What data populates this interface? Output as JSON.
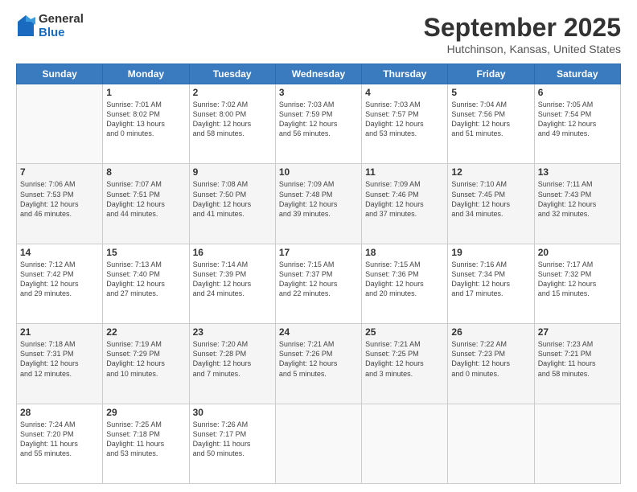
{
  "header": {
    "logo_general": "General",
    "logo_blue": "Blue",
    "month_title": "September 2025",
    "location": "Hutchinson, Kansas, United States"
  },
  "weekdays": [
    "Sunday",
    "Monday",
    "Tuesday",
    "Wednesday",
    "Thursday",
    "Friday",
    "Saturday"
  ],
  "weeks": [
    [
      {
        "day": "",
        "info": ""
      },
      {
        "day": "1",
        "info": "Sunrise: 7:01 AM\nSunset: 8:02 PM\nDaylight: 13 hours\nand 0 minutes."
      },
      {
        "day": "2",
        "info": "Sunrise: 7:02 AM\nSunset: 8:00 PM\nDaylight: 12 hours\nand 58 minutes."
      },
      {
        "day": "3",
        "info": "Sunrise: 7:03 AM\nSunset: 7:59 PM\nDaylight: 12 hours\nand 56 minutes."
      },
      {
        "day": "4",
        "info": "Sunrise: 7:03 AM\nSunset: 7:57 PM\nDaylight: 12 hours\nand 53 minutes."
      },
      {
        "day": "5",
        "info": "Sunrise: 7:04 AM\nSunset: 7:56 PM\nDaylight: 12 hours\nand 51 minutes."
      },
      {
        "day": "6",
        "info": "Sunrise: 7:05 AM\nSunset: 7:54 PM\nDaylight: 12 hours\nand 49 minutes."
      }
    ],
    [
      {
        "day": "7",
        "info": "Sunrise: 7:06 AM\nSunset: 7:53 PM\nDaylight: 12 hours\nand 46 minutes."
      },
      {
        "day": "8",
        "info": "Sunrise: 7:07 AM\nSunset: 7:51 PM\nDaylight: 12 hours\nand 44 minutes."
      },
      {
        "day": "9",
        "info": "Sunrise: 7:08 AM\nSunset: 7:50 PM\nDaylight: 12 hours\nand 41 minutes."
      },
      {
        "day": "10",
        "info": "Sunrise: 7:09 AM\nSunset: 7:48 PM\nDaylight: 12 hours\nand 39 minutes."
      },
      {
        "day": "11",
        "info": "Sunrise: 7:09 AM\nSunset: 7:46 PM\nDaylight: 12 hours\nand 37 minutes."
      },
      {
        "day": "12",
        "info": "Sunrise: 7:10 AM\nSunset: 7:45 PM\nDaylight: 12 hours\nand 34 minutes."
      },
      {
        "day": "13",
        "info": "Sunrise: 7:11 AM\nSunset: 7:43 PM\nDaylight: 12 hours\nand 32 minutes."
      }
    ],
    [
      {
        "day": "14",
        "info": "Sunrise: 7:12 AM\nSunset: 7:42 PM\nDaylight: 12 hours\nand 29 minutes."
      },
      {
        "day": "15",
        "info": "Sunrise: 7:13 AM\nSunset: 7:40 PM\nDaylight: 12 hours\nand 27 minutes."
      },
      {
        "day": "16",
        "info": "Sunrise: 7:14 AM\nSunset: 7:39 PM\nDaylight: 12 hours\nand 24 minutes."
      },
      {
        "day": "17",
        "info": "Sunrise: 7:15 AM\nSunset: 7:37 PM\nDaylight: 12 hours\nand 22 minutes."
      },
      {
        "day": "18",
        "info": "Sunrise: 7:15 AM\nSunset: 7:36 PM\nDaylight: 12 hours\nand 20 minutes."
      },
      {
        "day": "19",
        "info": "Sunrise: 7:16 AM\nSunset: 7:34 PM\nDaylight: 12 hours\nand 17 minutes."
      },
      {
        "day": "20",
        "info": "Sunrise: 7:17 AM\nSunset: 7:32 PM\nDaylight: 12 hours\nand 15 minutes."
      }
    ],
    [
      {
        "day": "21",
        "info": "Sunrise: 7:18 AM\nSunset: 7:31 PM\nDaylight: 12 hours\nand 12 minutes."
      },
      {
        "day": "22",
        "info": "Sunrise: 7:19 AM\nSunset: 7:29 PM\nDaylight: 12 hours\nand 10 minutes."
      },
      {
        "day": "23",
        "info": "Sunrise: 7:20 AM\nSunset: 7:28 PM\nDaylight: 12 hours\nand 7 minutes."
      },
      {
        "day": "24",
        "info": "Sunrise: 7:21 AM\nSunset: 7:26 PM\nDaylight: 12 hours\nand 5 minutes."
      },
      {
        "day": "25",
        "info": "Sunrise: 7:21 AM\nSunset: 7:25 PM\nDaylight: 12 hours\nand 3 minutes."
      },
      {
        "day": "26",
        "info": "Sunrise: 7:22 AM\nSunset: 7:23 PM\nDaylight: 12 hours\nand 0 minutes."
      },
      {
        "day": "27",
        "info": "Sunrise: 7:23 AM\nSunset: 7:21 PM\nDaylight: 11 hours\nand 58 minutes."
      }
    ],
    [
      {
        "day": "28",
        "info": "Sunrise: 7:24 AM\nSunset: 7:20 PM\nDaylight: 11 hours\nand 55 minutes."
      },
      {
        "day": "29",
        "info": "Sunrise: 7:25 AM\nSunset: 7:18 PM\nDaylight: 11 hours\nand 53 minutes."
      },
      {
        "day": "30",
        "info": "Sunrise: 7:26 AM\nSunset: 7:17 PM\nDaylight: 11 hours\nand 50 minutes."
      },
      {
        "day": "",
        "info": ""
      },
      {
        "day": "",
        "info": ""
      },
      {
        "day": "",
        "info": ""
      },
      {
        "day": "",
        "info": ""
      }
    ]
  ]
}
